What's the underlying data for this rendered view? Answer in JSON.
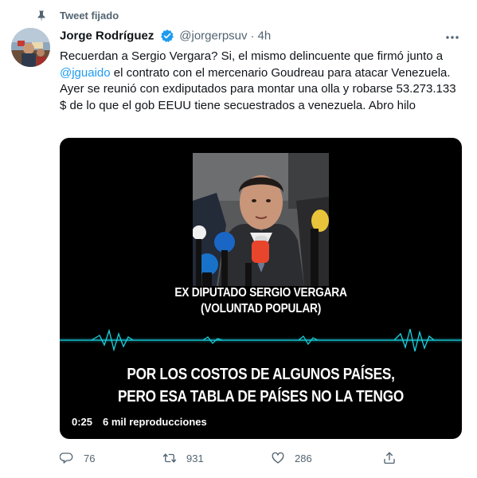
{
  "pinned": {
    "label": "Tweet fijado"
  },
  "author": {
    "display_name": "Jorge Rodríguez",
    "handle": "@jorgerpsuv",
    "separator": "·",
    "time": "4h"
  },
  "tweet": {
    "text_before": "Recuerdan a Sergio Vergara? Si, el mismo delincuente que firmó junto a ",
    "mention": "@jguaido",
    "text_after": " el contrato con el mercenario Goudreau para atacar Venezuela. Ayer se reunió con exdiputados para montar una olla y robarse 53.273.133 $ de lo que el gob EEUU tiene secuestrados a venezuela. Abro hilo"
  },
  "video": {
    "caption_name": "EX DIPUTADO SERGIO VERGARA",
    "caption_party": "(VOLUNTAD POPULAR)",
    "subtitle_line1": "POR LOS COSTOS DE ALGUNOS PAÍSES,",
    "subtitle_line2": "PERO ESA TABLA DE PAÍSES NO LA TENGO",
    "duration": "0:25",
    "views": "6 mil reproducciones"
  },
  "actions": {
    "replies": "76",
    "retweets": "931",
    "likes": "286"
  },
  "colors": {
    "link": "#1d9bf0",
    "secondary_text": "#536471",
    "verified": "#1d9bf0",
    "wave": "#19d3e0"
  },
  "icons": {
    "pin": "pin-icon",
    "verified": "verified-badge-icon",
    "more": "more-options-icon",
    "reply": "reply-icon",
    "retweet": "retweet-icon",
    "like": "heart-icon",
    "share": "share-icon"
  }
}
